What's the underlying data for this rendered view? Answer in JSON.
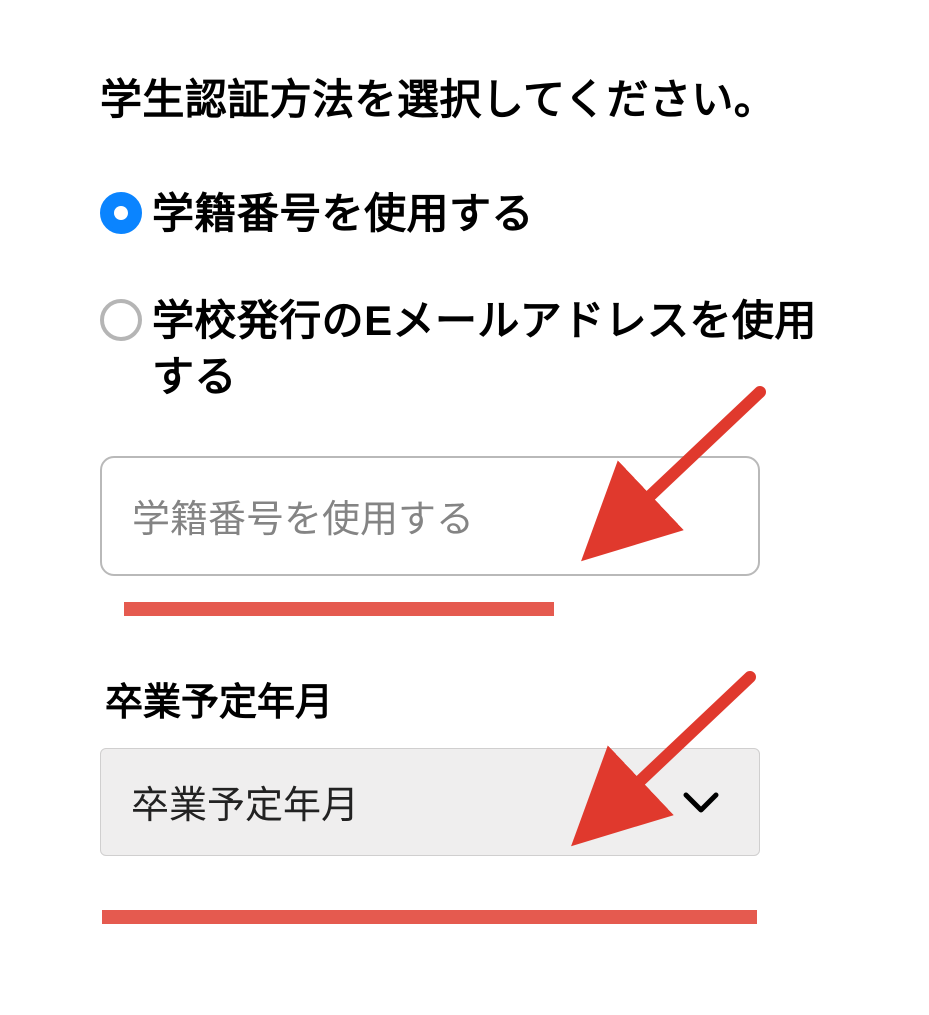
{
  "prompt": "学生認証方法を選択してください。",
  "radios": {
    "student_id": {
      "label": "学籍番号を使用する",
      "selected": true
    },
    "school_email": {
      "label": "学校発行のEメールアドレスを使用する",
      "selected": false
    }
  },
  "text_input": {
    "placeholder": "学籍番号を使用する"
  },
  "graduation": {
    "label": "卒業予定年月",
    "placeholder": "卒業予定年月"
  },
  "annotations": {
    "highlight_color": "#e55a4f",
    "arrow_color": "#e0392d"
  }
}
